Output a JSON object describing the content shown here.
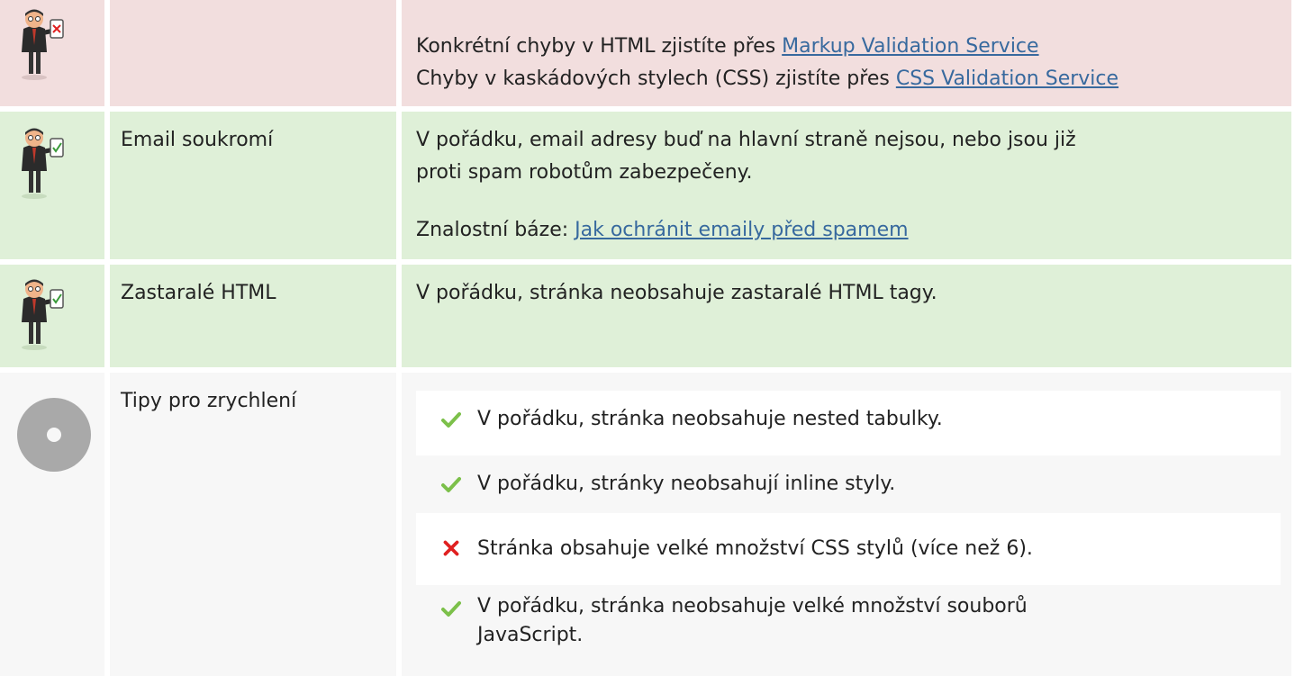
{
  "rows": [
    {
      "status": "fail",
      "label": "",
      "lines": [
        {
          "prefix": "Konkrétní chyby v HTML zjistíte přes ",
          "link": "Markup Validation Service"
        },
        {
          "prefix": "Chyby v kaskádových stylech (CSS) zjistíte přes ",
          "link": "CSS Validation Service"
        }
      ]
    },
    {
      "status": "pass",
      "label": "Email soukromí",
      "lines": [
        {
          "text": "V pořádku, email adresy buď na hlavní straně nejsou, nebo jsou již"
        },
        {
          "text": "proti spam robotům zabezpečeny."
        },
        {
          "prefix": "Znalostní báze: ",
          "link": "Jak ochránit emaily před spamem"
        }
      ]
    },
    {
      "status": "pass",
      "label": "Zastaralé HTML",
      "lines": [
        {
          "text": "V pořádku, stránka neobsahuje zastaralé HTML tagy."
        }
      ]
    },
    {
      "status": "info",
      "label": "Tipy pro zrychlení",
      "items": [
        {
          "status": "pass",
          "lines": [
            "V pořádku, stránka neobsahuje nested tabulky."
          ]
        },
        {
          "status": "pass",
          "lines": [
            "V pořádku, stránky neobsahují inline styly."
          ]
        },
        {
          "status": "fail",
          "lines": [
            "Stránka obsahuje velké množství CSS stylů (více než 6)."
          ]
        },
        {
          "status": "pass",
          "lines": [
            "V pořádku, stránka neobsahuje velké množství souborů",
            "JavaScript."
          ]
        }
      ]
    }
  ],
  "colors": {
    "fail_bg": "#f2dede",
    "pass_bg": "#dff0d8",
    "info_bg": "#f7f7f7",
    "link": "#37699e",
    "check": "#7cc04a",
    "cross": "#e02020"
  },
  "icons": {
    "fail": "businessman-clipboard-cross-icon",
    "pass": "businessman-clipboard-check-icon",
    "info": "gray-disc-icon",
    "item_pass": "checkmark-icon",
    "item_fail": "cross-icon"
  }
}
